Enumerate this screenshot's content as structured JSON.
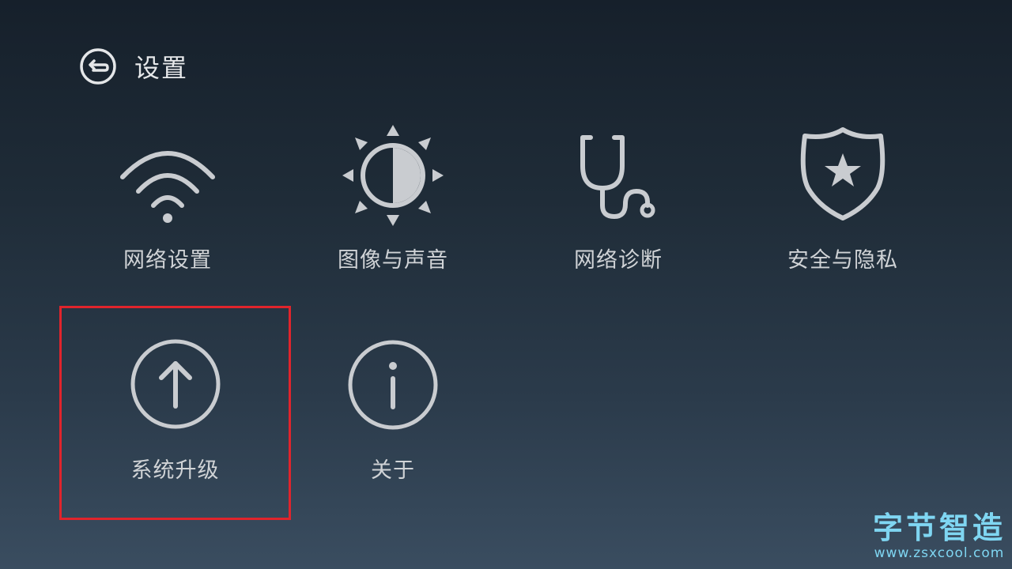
{
  "header": {
    "title": "设置",
    "back_icon": "back-icon"
  },
  "tiles": [
    {
      "label": "网络设置",
      "icon": "wifi-icon"
    },
    {
      "label": "图像与声音",
      "icon": "brightness-icon"
    },
    {
      "label": "网络诊断",
      "icon": "stethoscope-icon"
    },
    {
      "label": "安全与隐私",
      "icon": "shield-star-icon"
    },
    {
      "label": "系统升级",
      "icon": "upgrade-arrow-icon",
      "focused": true
    },
    {
      "label": "关于",
      "icon": "info-icon"
    }
  ],
  "focus_color": "#e0242c",
  "watermark": {
    "title": "字节智造",
    "url": "www.zsxcool.com"
  }
}
